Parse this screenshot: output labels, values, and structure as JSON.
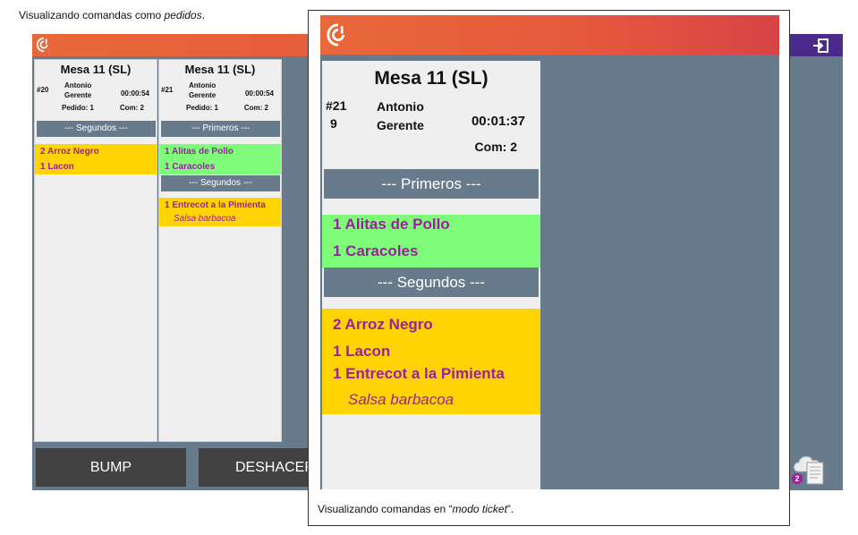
{
  "captions": {
    "top_prefix": "Visualizando comandas como ",
    "top_emph": "pedidos",
    "top_suffix": ".",
    "bottom_prefix": "Visualizando comandas en “",
    "bottom_emph": "modo ticket",
    "bottom_suffix": "”."
  },
  "colors": {
    "topbar_start": "#e8683a",
    "topbar_end": "#d84346",
    "background": "#687b8c",
    "card": "#efefef",
    "green_items": "#7ffc7a",
    "yellow_items": "#ffd400",
    "item_text": "#9b1fa0",
    "button": "#424242",
    "purple": "#4a2b8c"
  },
  "icons": {
    "app_logo": "app-logo-icon",
    "settings": "gear-icon",
    "logout": "logout-icon",
    "tray": "printer-tray-icon"
  },
  "orders_view": {
    "orders": [
      {
        "table": "Mesa 11 (SL)",
        "number": "#20",
        "waiter_line1": "Antonio",
        "waiter_line2": "Gerente",
        "time": "00:00:54",
        "pedido": "Pedido: 1",
        "com": "Com: 2",
        "sections": [
          {
            "title": "--- Segundos ---",
            "items": [
              "2 Arroz Negro",
              "1 Lacon"
            ],
            "modifiers": []
          }
        ]
      },
      {
        "table": "Mesa 11 (SL)",
        "number": "#21",
        "waiter_line1": "Antonio",
        "waiter_line2": "Gerente",
        "time": "00:00:54",
        "pedido": "Pedido: 1",
        "com": "Com: 2",
        "sections": [
          {
            "title": "--- Primeros ---",
            "items": [
              "1 Alitas de Pollo",
              "1 Caracoles"
            ],
            "modifiers": []
          },
          {
            "title": "--- Segundos ---",
            "items": [
              "1 Entrecot a la Pimienta"
            ],
            "modifiers": [
              "Salsa barbacoa"
            ]
          }
        ]
      }
    ],
    "buttons": {
      "bump": "BUMP",
      "undo": "DESHACER"
    },
    "badge_count": "2"
  },
  "ticket_view": {
    "table": "Mesa 11 (SL)",
    "number_line1": "#21",
    "number_line2": "9",
    "waiter_line1": "Antonio",
    "waiter_line2": "Gerente",
    "time": "00:01:37",
    "com": "Com: 2",
    "primeros_title": "--- Primeros ---",
    "primeros_items": [
      "1 Alitas de Pollo",
      "1 Caracoles"
    ],
    "segundos_title": "--- Segundos ---",
    "segundos_items": [
      "2 Arroz Negro",
      "1 Lacon",
      "1 Entrecot a la Pimienta"
    ],
    "segundos_modifier": "Salsa barbacoa"
  }
}
